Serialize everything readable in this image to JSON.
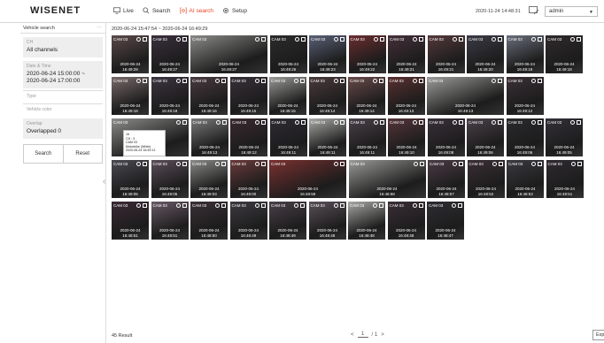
{
  "brand": {
    "logo": "WISENET"
  },
  "nav": [
    {
      "label": "Live",
      "icon": "monitor-icon",
      "active": false
    },
    {
      "label": "Search",
      "icon": "search-icon",
      "active": false
    },
    {
      "label": "AI search",
      "icon": "ai-search-icon",
      "active": true
    },
    {
      "label": "Setup",
      "icon": "gear-icon",
      "active": false
    }
  ],
  "header": {
    "clock": "2020-11-24 14:48:31",
    "user": "admin"
  },
  "sidebar": {
    "title": "Vehicle search",
    "more": "···",
    "ch_label": "CH",
    "ch_value": "All channels",
    "dt_label": "Date & Time",
    "dt_value_1": "2020-06-24 15:00:00 ~",
    "dt_value_2": "2020-06-24 17:00:00",
    "type_label": "Type",
    "color_label": "Vehicle color",
    "overlap_label": "Overlap",
    "overlap_value": "Overlapped 0",
    "search_btn": "Search",
    "reset_btn": "Reset",
    "collapse": "‹"
  },
  "main": {
    "range": "2020-06-24 15:47:54 ~ 2020-06-24 16:49:29",
    "result": "45 Result",
    "page_prev": "<",
    "page_current": "1",
    "page_sep": "/ 1",
    "page_next": ">",
    "export": "Exp"
  },
  "tooltip": {
    "l1": "16",
    "l2": "CH : 3",
    "l3": "CAM 03",
    "l4": "Motorbike (White)",
    "l5": "2020-06-24 16:49:13"
  },
  "thumbs": [
    {
      "cam": "CAM 03",
      "date": "2020-06-24",
      "time": "16:49:29",
      "tone": "#5c4a4a"
    },
    {
      "cam": "CAM 03",
      "date": "2020-06-24",
      "time": "16:49:27",
      "tone": "#3a2f3d"
    },
    {
      "cam": "CAM 03",
      "date": "2020-06-24",
      "time": "16:49:27",
      "tone": "#8a8a88",
      "wide": true
    },
    {
      "cam": "CAM 03",
      "date": "2020-06-24",
      "time": "16:49:26",
      "tone": "#2b2b2b"
    },
    {
      "cam": "CAM 03",
      "date": "2020-06-24",
      "time": "16:49:23",
      "tone": "#5a6178"
    },
    {
      "cam": "CAM 03",
      "date": "2020-06-24",
      "time": "16:49:22",
      "tone": "#6b2e30"
    },
    {
      "cam": "CAM 03",
      "date": "2020-06-24",
      "time": "16:49:21",
      "tone": "#45303a"
    },
    {
      "cam": "CAM 03",
      "date": "2020-06-24",
      "time": "16:49:21",
      "tone": "#55393a"
    },
    {
      "cam": "CAM 03",
      "date": "2020-06-24",
      "time": "16:49:20",
      "tone": "#3b3b46"
    },
    {
      "cam": "CAM 03",
      "date": "2020-06-24",
      "time": "16:49:19",
      "tone": "#6a6f7c"
    },
    {
      "cam": "CAM 03",
      "date": "2020-06-24",
      "time": "16:49:18",
      "tone": "#2f2a2c"
    },
    {
      "cam": "CAM 03",
      "date": "2020-06-24",
      "time": "16:49:18",
      "tone": "#7a6a6a"
    },
    {
      "cam": "CAM 03",
      "date": "2020-06-24",
      "time": "16:49:18",
      "tone": "#3d3440"
    },
    {
      "cam": "CAM 03",
      "date": "2020-06-24",
      "time": "16:49:16",
      "tone": "#4a3a40"
    },
    {
      "cam": "CAM 03",
      "date": "2020-06-24",
      "time": "16:49:15",
      "tone": "#383038"
    },
    {
      "cam": "CAM 03",
      "date": "2020-06-24",
      "time": "16:49:15",
      "tone": "#9a9a98"
    },
    {
      "cam": "CAM 03",
      "date": "2020-06-24",
      "time": "16:49:14",
      "tone": "#4a3a3c"
    },
    {
      "cam": "CAM 03",
      "date": "2020-06-24",
      "time": "16:49:14",
      "tone": "#6a4a4a"
    },
    {
      "cam": "CAM 03",
      "date": "2020-06-24",
      "time": "16:49:13",
      "tone": "#5a3030"
    },
    {
      "cam": "CAM 03",
      "date": "2020-06-24",
      "time": "16:49:13",
      "tone": "#9c9c9a",
      "wide": true
    },
    {
      "cam": "CAM 03",
      "date": "2020-06-24",
      "time": "16:49:12",
      "tone": "#3a3036"
    },
    {
      "cam": "CAM 03",
      "date": "2020-06-24",
      "time": "16:49:13",
      "tone": "#8c8c8a",
      "wide": true,
      "tooltip": true
    },
    {
      "cam": "CAM 03",
      "date": "2020-06-24",
      "time": "16:49:13",
      "tone": "#7a7a7a"
    },
    {
      "cam": "CAM 03",
      "date": "2020-06-24",
      "time": "16:49:12",
      "tone": "#3a2a30"
    },
    {
      "cam": "CAM 03",
      "date": "2020-06-24",
      "time": "16:49:11",
      "tone": "#2e2a33"
    },
    {
      "cam": "CAM 03",
      "date": "2020-06-24",
      "time": "16:49:11",
      "tone": "#a8a8a6"
    },
    {
      "cam": "CAM 03",
      "date": "2020-06-24",
      "time": "16:49:11",
      "tone": "#4b4048"
    },
    {
      "cam": "CAM 03",
      "date": "2020-06-24",
      "time": "16:49:10",
      "tone": "#55353a"
    },
    {
      "cam": "CAM 03",
      "date": "2020-06-24",
      "time": "16:49:08",
      "tone": "#3a303a"
    },
    {
      "cam": "CAM 03",
      "date": "2020-06-24",
      "time": "16:49:06",
      "tone": "#4a4048"
    },
    {
      "cam": "CAM 03",
      "date": "2020-06-24",
      "time": "16:49:06",
      "tone": "#2a2a2e"
    },
    {
      "cam": "CAM 03",
      "date": "2020-06-24",
      "time": "16:49:05",
      "tone": "#333038"
    },
    {
      "cam": "CAM 03",
      "date": "2020-06-24",
      "time": "16:49:05",
      "tone": "#4a4a52"
    },
    {
      "cam": "CAM 03",
      "date": "2020-06-24",
      "time": "16:49:05",
      "tone": "#5a4e58"
    },
    {
      "cam": "CAM 03",
      "date": "2020-06-24",
      "time": "16:49:03",
      "tone": "#8a8a88"
    },
    {
      "cam": "CAM 03",
      "date": "2020-06-24",
      "time": "16:49:00",
      "tone": "#6a3a3a"
    },
    {
      "cam": "CAM 03",
      "date": "2020-06-24",
      "time": "16:48:59",
      "tone": "#7a3030",
      "wide": true
    },
    {
      "cam": "CAM 03",
      "date": "2020-06-24",
      "time": "16:48:58",
      "tone": "#9a9a98",
      "wide": true
    },
    {
      "cam": "CAM 03",
      "date": "2020-06-24",
      "time": "16:48:57",
      "tone": "#4a3a44"
    },
    {
      "cam": "CAM 03",
      "date": "2020-06-24",
      "time": "16:48:52",
      "tone": "#3a2e34"
    },
    {
      "cam": "CAM 03",
      "date": "2020-06-24",
      "time": "16:48:53",
      "tone": "#3a3a40"
    },
    {
      "cam": "CAM 03",
      "date": "2020-06-24",
      "time": "16:48:51",
      "tone": "#2e2a30"
    },
    {
      "cam": "CAM 03",
      "date": "2020-06-24",
      "time": "16:48:51",
      "tone": "#3a2a34"
    },
    {
      "cam": "CAM 03",
      "date": "2020-06-24",
      "time": "16:48:51",
      "tone": "#6a5a66"
    },
    {
      "cam": "CAM 03",
      "date": "2020-06-24",
      "time": "16:48:50",
      "tone": "#3a3036"
    },
    {
      "cam": "CAM 03",
      "date": "2020-06-24",
      "time": "16:48:49",
      "tone": "#3e3a40"
    },
    {
      "cam": "CAM 03",
      "date": "2020-06-24",
      "time": "16:48:49",
      "tone": "#4a4048"
    },
    {
      "cam": "CAM 03",
      "date": "2020-06-24",
      "time": "16:48:48",
      "tone": "#5a5058"
    },
    {
      "cam": "CAM 03",
      "date": "2020-06-24",
      "time": "16:48:48",
      "tone": "#a8a8a6"
    },
    {
      "cam": "CAM 03",
      "date": "2020-06-24",
      "time": "16:48:48",
      "tone": "#3a2e36"
    },
    {
      "cam": "CAM 03",
      "date": "2020-06-24",
      "time": "16:48:47",
      "tone": "#2e2c32"
    }
  ]
}
